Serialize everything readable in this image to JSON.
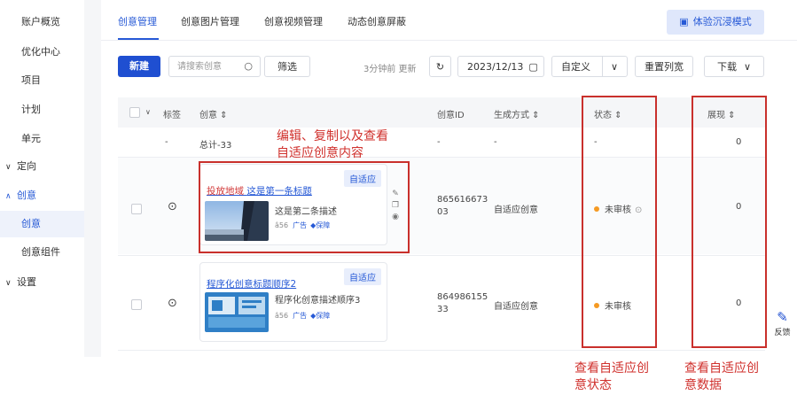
{
  "sidebar": {
    "items": [
      {
        "label": "账户概览"
      },
      {
        "label": "优化中心"
      },
      {
        "label": "项目"
      },
      {
        "label": "计划"
      },
      {
        "label": "单元"
      },
      {
        "label": "定向",
        "chevron": "chevron-right-icon"
      },
      {
        "label": "创意",
        "chevron": "chevron-up-icon"
      },
      {
        "label": "创意"
      },
      {
        "label": "创意组件"
      },
      {
        "label": "设置",
        "chevron": "chevron-right-icon"
      }
    ]
  },
  "tabs": [
    {
      "label": "创意管理"
    },
    {
      "label": "创意图片管理"
    },
    {
      "label": "创意视频管理"
    },
    {
      "label": "动态创意屏蔽"
    }
  ],
  "header": {
    "immersive_label": "体验沉浸模式"
  },
  "toolbar": {
    "new_label": "新建",
    "search_placeholder": "请搜索创意",
    "filter_label": "筛选",
    "updated_text": "3分钟前 更新",
    "date_value": "2023/12/13",
    "custom_label": "自定义",
    "reset_label": "重置列宽",
    "download_label": "下载"
  },
  "table": {
    "headers": {
      "tag": "标签",
      "creative": "创意 ⇕",
      "id": "创意ID",
      "gen": "生成方式 ⇕",
      "status": "状态 ⇕",
      "impressions": "展现 ⇕"
    },
    "summary": {
      "creative": "总计-33",
      "id": "-",
      "gen": "-",
      "status": "-",
      "impressions": "0"
    },
    "rows": [
      {
        "card_tag": "自适应",
        "title_red": "投放地域",
        "title_rest": "这是第一条标题",
        "desc": "这是第二条描述",
        "meta_name": "â56",
        "meta_ad": "广告",
        "meta_badge": "保障",
        "id_line1": "865616673",
        "id_line2": "03",
        "gen": "自适应创意",
        "status": "未审核",
        "impressions": "0"
      },
      {
        "card_tag": "自适应",
        "title_red": "",
        "title_rest": "程序化创意标题顺序2",
        "desc": "程序化创意描述顺序3",
        "meta_name": "â56",
        "meta_ad": "广告",
        "meta_badge": "保障",
        "id_line1": "864986155",
        "id_line2": "33",
        "gen": "自适应创意",
        "status": "未审核",
        "impressions": "0"
      }
    ]
  },
  "annotations": {
    "edit_line1": "编辑、复制以及查看",
    "edit_line2": "自适应创意内容",
    "status_line1": "查看自适应创",
    "status_line2": "意状态",
    "data_line1": "查看自适应创",
    "data_line2": "意数据"
  },
  "feedback_label": "反馈",
  "colors": {
    "primary": "#1f4fd1",
    "accent": "#2659d6",
    "annotation": "#d0312d",
    "pending": "#f59a23"
  }
}
